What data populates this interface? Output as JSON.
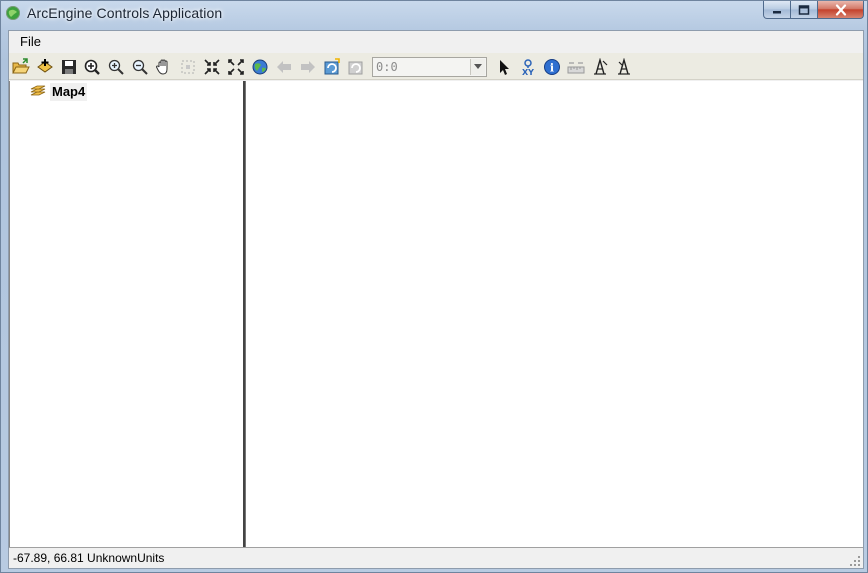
{
  "window": {
    "title": "ArcEngine Controls Application"
  },
  "menu": {
    "items": [
      "File"
    ]
  },
  "toolbar": {
    "scale_value": "0:0",
    "buttons": [
      "open-document",
      "add-data",
      "save",
      "zoom-in-fixed",
      "zoom-in",
      "zoom-out",
      "pan",
      "zoom-to-selected",
      "fixed-zoom-in",
      "fixed-zoom-out",
      "full-extent",
      "back-extent",
      "forward-extent",
      "refresh",
      "page-refresh",
      "select",
      "go-to-xy",
      "identify",
      "measure",
      "find",
      "hyperlink"
    ]
  },
  "toc": {
    "map_name": "Map4"
  },
  "status": {
    "coordinates": "-67.89, 66.81",
    "units": "UnknownUnits",
    "text": "-67.89, 66.81  UnknownUnits"
  },
  "colors": {
    "title_bar": "#b9cbe0",
    "close_button": "#c4422c",
    "client_bg": "#f0f0f0",
    "toolbar_bg": "#ecebe2"
  }
}
